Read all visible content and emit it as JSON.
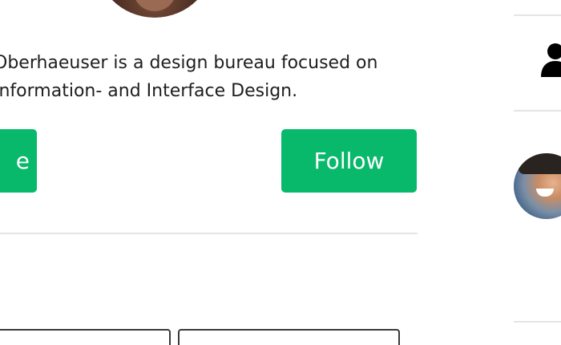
{
  "profile": {
    "bio_line_1": "Oberhaeuser is a design bureau focused on",
    "bio_line_2": "Information- and Interface Design."
  },
  "actions": {
    "left_button_label": "e",
    "follow_label": "Follow"
  },
  "colors": {
    "accent": "#08b86b",
    "divider": "#e4e4ea",
    "text": "#1e1e1e"
  },
  "icons": {
    "sidebar_user": "user-icon"
  }
}
